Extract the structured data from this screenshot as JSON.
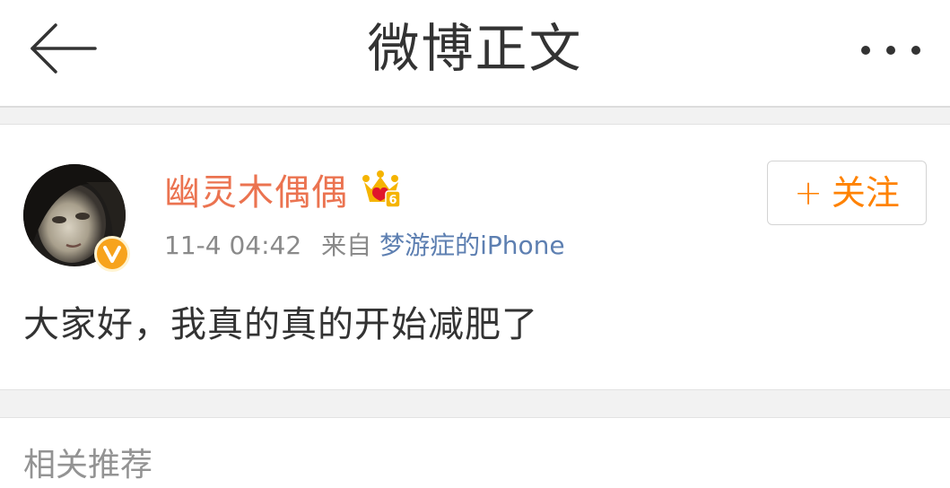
{
  "nav": {
    "title": "微博正文",
    "back_icon": "arrow-left-icon",
    "more_icon": "ellipsis-icon"
  },
  "post": {
    "author": "幽灵木偶偶",
    "verified_icon": "verified-v-icon",
    "vip_icon": "crown-vip-icon",
    "time": "11-4 04:42",
    "source_prefix": "来自",
    "source": "梦游症的iPhone",
    "content": "大家好，我真的真的开始减肥了",
    "follow_plus": "+",
    "follow_label": "关注"
  },
  "related": {
    "title": "相关推荐"
  },
  "colors": {
    "accent": "#ff8200",
    "username": "#eb7350",
    "source_link": "#5d7fb1",
    "badge": "#f7a31c"
  }
}
